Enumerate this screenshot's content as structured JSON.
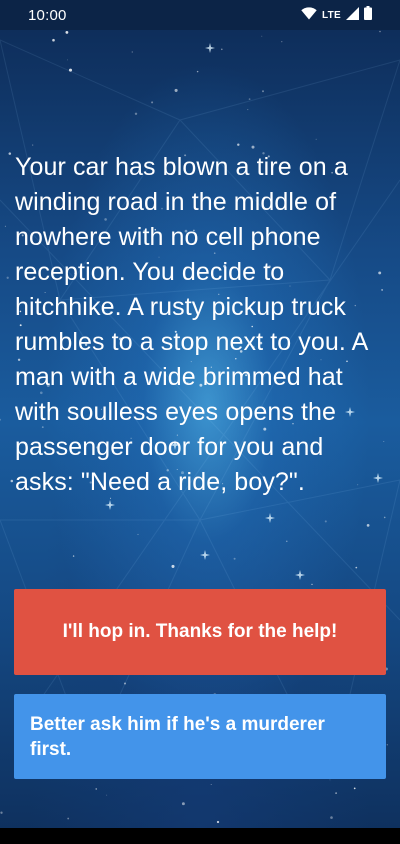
{
  "status_bar": {
    "time": "10:00",
    "network_label": "LTE",
    "icons": [
      "wifi-icon",
      "signal-icon",
      "battery-icon"
    ]
  },
  "story": {
    "text": "Your car has blown a tire on a winding road in the middle of nowhere with no cell phone reception. You decide to hitchhike. A rusty pickup truck rumbles to a stop next to you. A man with a wide brimmed hat with soulless eyes opens the passenger door for you and asks: \"Need a ride, boy?\"."
  },
  "choices": [
    {
      "label": "I'll hop in. Thanks for the help!",
      "color": "#e05242"
    },
    {
      "label": "Better ask him if he's a murderer first.",
      "color": "#4394ea"
    }
  ],
  "colors": {
    "background_dark": "#0d2a55",
    "background_glow": "#5ac8ff",
    "text": "#ffffff"
  }
}
